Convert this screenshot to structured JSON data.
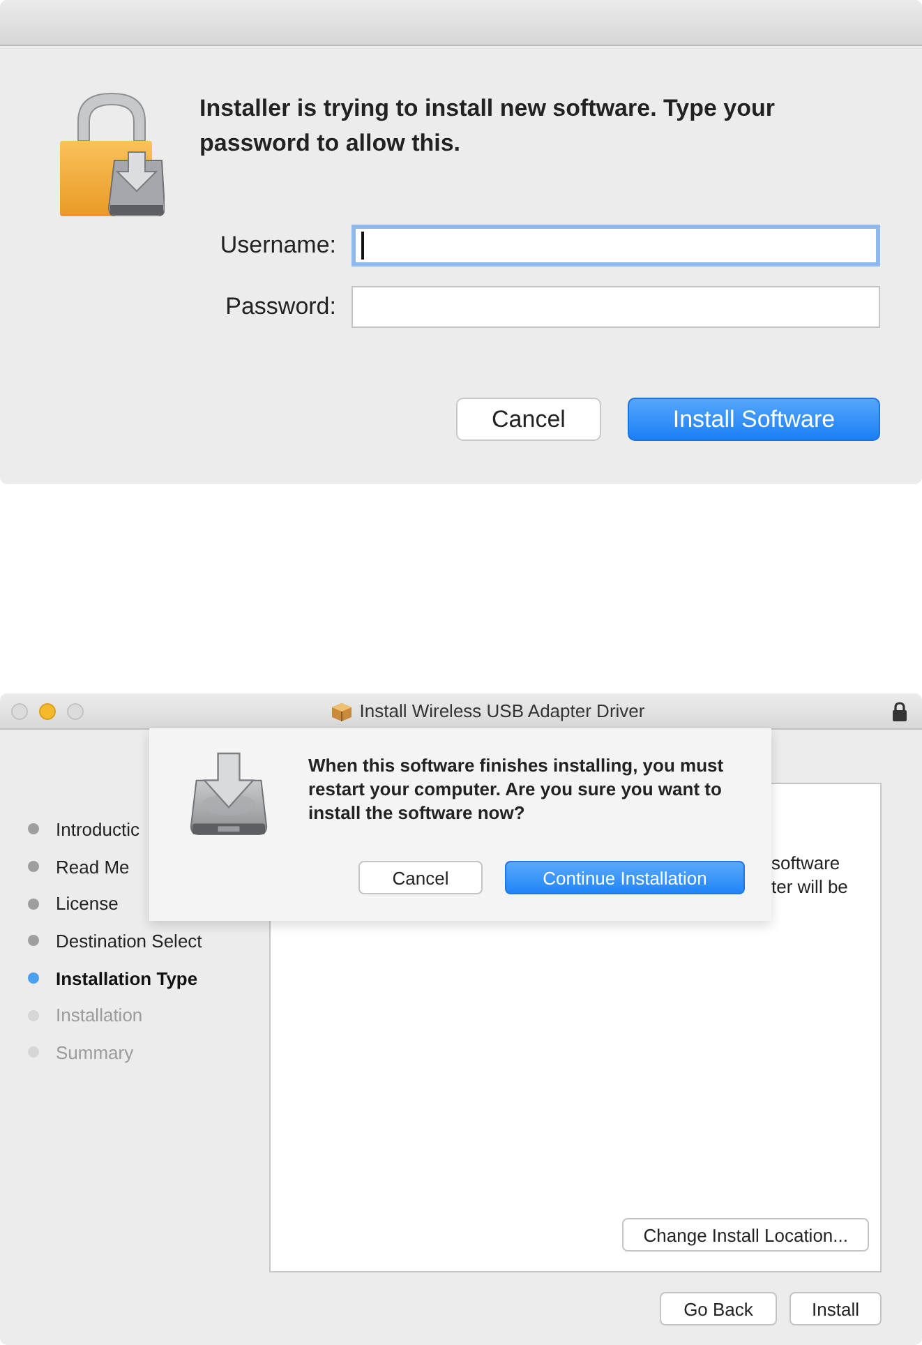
{
  "auth_dialog": {
    "message": "Installer is trying to install new software. Type your password to allow this.",
    "fields": [
      {
        "label": "Username:",
        "focused": true
      },
      {
        "label": "Password:",
        "focused": false
      }
    ],
    "buttons": [
      {
        "label": "Cancel",
        "default": false
      },
      {
        "label": "Install Software",
        "default": true
      }
    ]
  },
  "installer_window": {
    "title": "Install Wireless USB Adapter Driver",
    "sidebar": {
      "items": [
        {
          "label": "Introductic",
          "selected": false,
          "disabled": false
        },
        {
          "label": "Read Me",
          "selected": false,
          "disabled": false
        },
        {
          "label": "License",
          "selected": false,
          "disabled": false
        },
        {
          "label": "Destination Select",
          "selected": false,
          "disabled": false
        },
        {
          "label": "Installation Type",
          "selected": true,
          "disabled": false
        },
        {
          "label": "Installation",
          "selected": false,
          "disabled": true
        },
        {
          "label": "Summary",
          "selected": false,
          "disabled": true
        }
      ]
    },
    "content_text": [
      "software",
      "ter will be"
    ],
    "change_location_button": "Change Install Location...",
    "buttons": [
      {
        "label": "Go Back",
        "default": false
      },
      {
        "label": "Install",
        "default": false
      }
    ],
    "sheet": {
      "message": "When this software finishes installing, you must restart your computer. Are you sure you want to install the software now?",
      "buttons": [
        {
          "label": "Cancel",
          "default": false
        },
        {
          "label": "Continue Installation",
          "default": true
        }
      ]
    }
  }
}
